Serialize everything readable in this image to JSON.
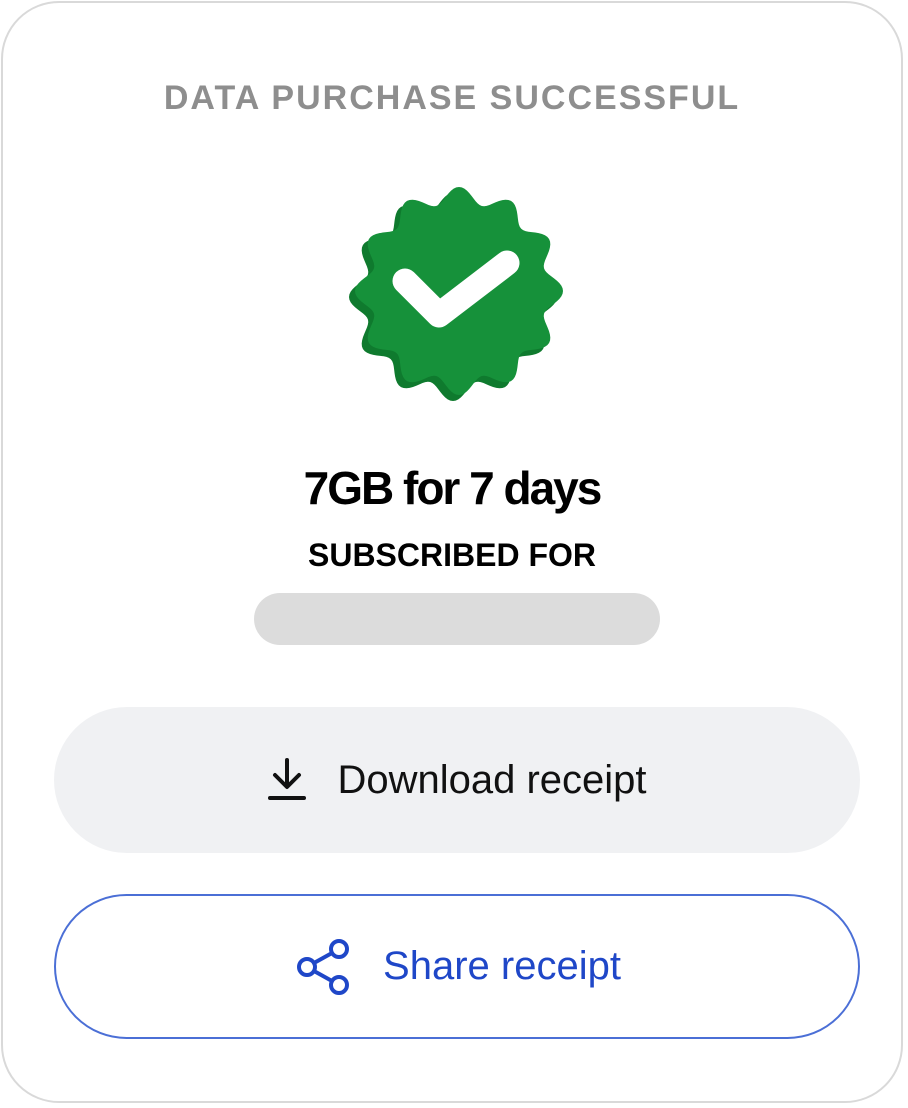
{
  "header": {
    "status_text": "DATA PURCHASE SUCCESSFUL"
  },
  "badge": {
    "icon": "verified-check-badge-icon",
    "color": "#16913a",
    "shade_color": "#0f7a2e"
  },
  "plan": {
    "title": "7GB for 7 days",
    "subscribed_label": "SUBSCRIBED FOR"
  },
  "actions": {
    "download_label": "Download receipt",
    "download_icon": "download-icon",
    "share_label": "Share receipt",
    "share_icon": "share-icon",
    "accent_color": "#1f47c8"
  }
}
